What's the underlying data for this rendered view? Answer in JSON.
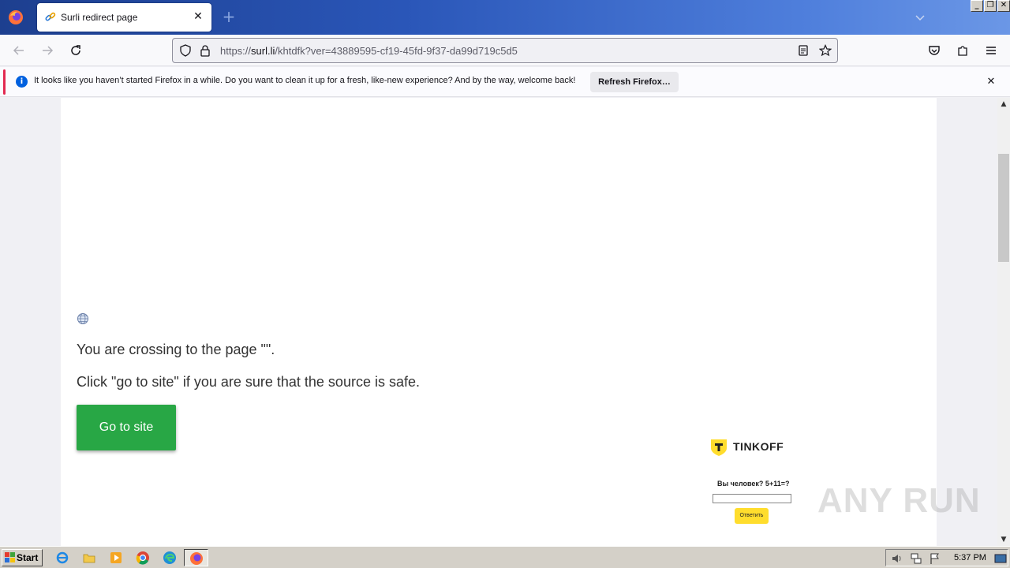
{
  "browser": {
    "tab_title": "Surli redirect page",
    "url_prefix": "https://",
    "url_domain": "surl.li",
    "url_path": "/khtdfk?ver=43889595-cf19-45fd-9f37-da99d719c5d5"
  },
  "notification": {
    "message": "It looks like you haven’t started Firefox in a while. Do you want to clean it up for a fresh, like-new experience? And by the way, welcome back!",
    "button_label": "Refresh Firefox…"
  },
  "page": {
    "crossing_text": "You are crossing to the page \"\".",
    "instruction_text": "Click \"go to site\" if you are sure that the source is safe.",
    "go_button_label": "Go to site"
  },
  "ad": {
    "brand": "TINKOFF",
    "question": "Вы человек? 5+11=?",
    "answer_button": "Ответить"
  },
  "watermark": "ANY RUN",
  "taskbar": {
    "start_label": "Start",
    "clock": "5:37 PM"
  },
  "colors": {
    "go_button": "#28a745",
    "tinkoff_yellow": "#ffdd2d",
    "notification_accent": "#e22850"
  }
}
